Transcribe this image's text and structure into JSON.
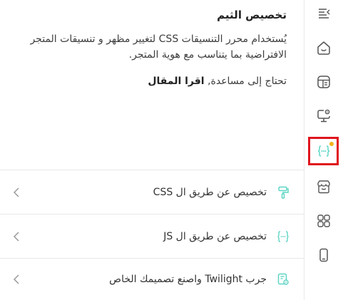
{
  "panel": {
    "title": "تخصيص الثيم",
    "description": "يُستخدام محرر التنسيقات CSS لتغيير مظهر و تنسيقات المتجر الافتراضية بما يتناسب مع هوية المتجر.",
    "help_prefix": "تحتاج إلى مساعدة,",
    "help_link": "اقرا المقال"
  },
  "rows": [
    {
      "label": "تخصيص عن طريق ال CSS",
      "icon": "paint-roller-icon"
    },
    {
      "label": "تخصيص عن طريق ال JS",
      "icon": "code-braces-icon"
    },
    {
      "label": "جرب Twilight واصنع تصميمك الخاص",
      "icon": "design-file-icon"
    }
  ],
  "rail": {
    "items": [
      {
        "icon": "menu-collapse-icon"
      },
      {
        "icon": "home-icon"
      },
      {
        "icon": "layout-template-icon"
      },
      {
        "icon": "monitor-settings-icon"
      },
      {
        "icon": "code-braces-icon",
        "active": true,
        "badge_color": "#f2b21b"
      },
      {
        "icon": "store-icon"
      },
      {
        "icon": "apps-grid-icon"
      },
      {
        "icon": "mobile-icon"
      }
    ]
  },
  "colors": {
    "accent": "#5dd5c4",
    "active_outline": "#e0141e",
    "badge": "#f2b21b"
  }
}
